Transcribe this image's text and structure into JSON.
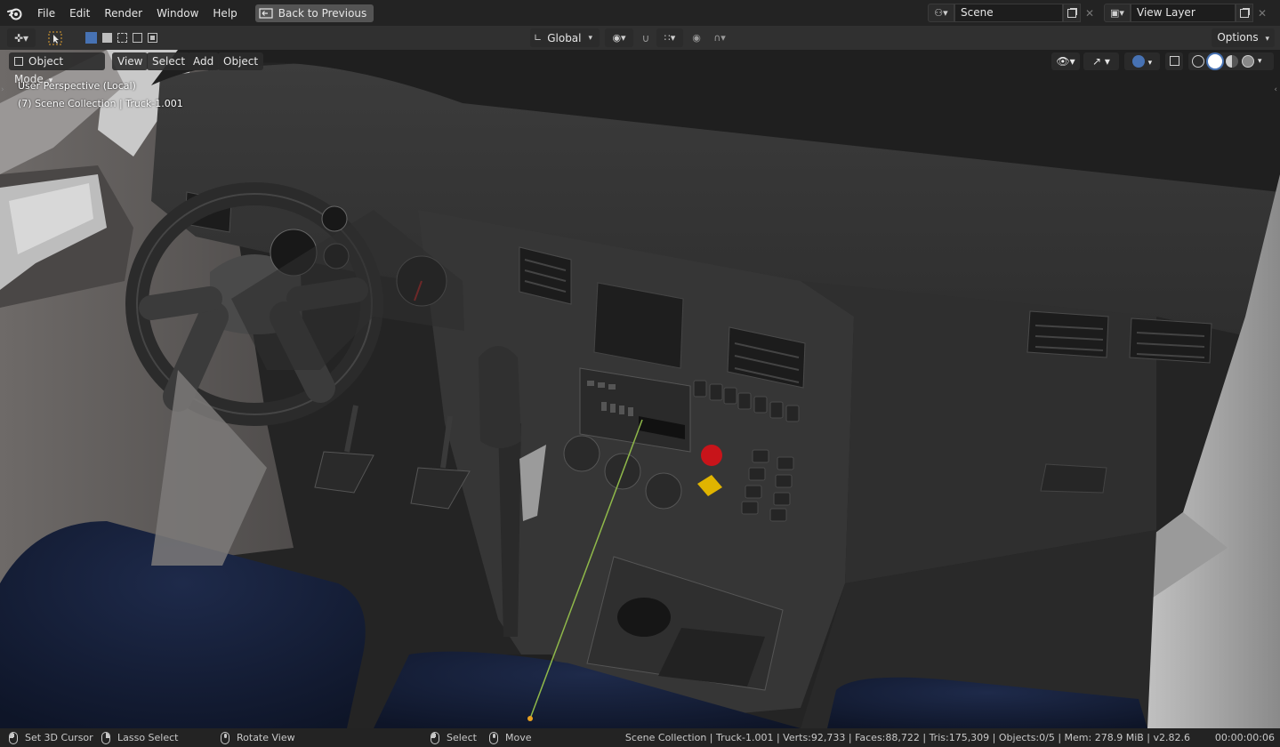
{
  "topbar": {
    "menu": [
      "File",
      "Edit",
      "Render",
      "Window",
      "Help"
    ],
    "back_button": "Back to Previous",
    "scene_name": "Scene",
    "view_layer_name": "View Layer"
  },
  "toolheader": {
    "orientation": "Global",
    "options_label": "Options"
  },
  "viewport": {
    "mode": "Object Mode",
    "menu": [
      "View",
      "Select",
      "Add",
      "Object"
    ],
    "overlay_line1": "User Perspective (Local)",
    "overlay_line2": "(7) Scene Collection | Truck-1.001"
  },
  "statusbar": {
    "set_cursor": "Set 3D Cursor",
    "lasso": "Lasso Select",
    "rotate": "Rotate View",
    "select": "Select",
    "move": "Move",
    "stats": "Scene Collection | Truck-1.001 | Verts:92,733 | Faces:88,722 | Tris:175,309 | Objects:0/5 | Mem: 278.9 MiB | v2.82.6",
    "time": "00:00:00:06"
  },
  "colors": {
    "accent_blue": "#4772b3",
    "header_bg": "#303030",
    "topbar_bg": "#232323"
  }
}
